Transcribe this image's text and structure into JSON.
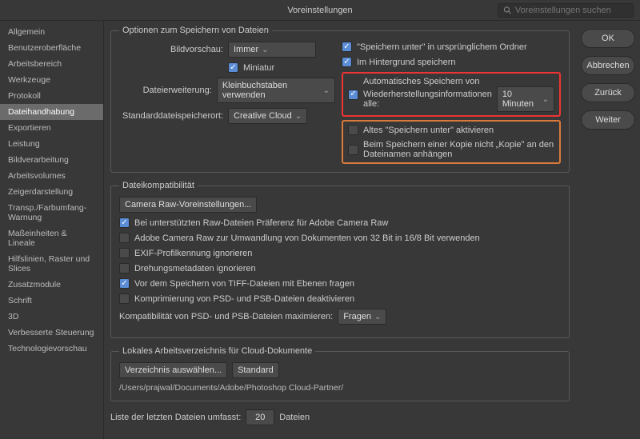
{
  "title": "Voreinstellungen",
  "searchPlaceholder": "Voreinstellungen suchen",
  "sidebar": {
    "items": [
      {
        "label": "Allgemein"
      },
      {
        "label": "Benutzeroberfläche"
      },
      {
        "label": "Arbeitsbereich"
      },
      {
        "label": "Werkzeuge"
      },
      {
        "label": "Protokoll"
      },
      {
        "label": "Dateihandhabung"
      },
      {
        "label": "Exportieren"
      },
      {
        "label": "Leistung"
      },
      {
        "label": "Bildverarbeitung"
      },
      {
        "label": "Arbeitsvolumes"
      },
      {
        "label": "Zeigerdarstellung"
      },
      {
        "label": "Transp./Farbumfang-Warnung"
      },
      {
        "label": "Maßeinheiten & Lineale"
      },
      {
        "label": "Hilfslinien, Raster und Slices"
      },
      {
        "label": "Zusatzmodule"
      },
      {
        "label": "Schrift"
      },
      {
        "label": "3D"
      },
      {
        "label": "Verbesserte Steuerung"
      },
      {
        "label": "Technologievorschau"
      }
    ]
  },
  "buttons": {
    "ok": "OK",
    "cancel": "Abbrechen",
    "back": "Zurück",
    "next": "Weiter"
  },
  "fs1": {
    "legend": "Optionen zum Speichern von Dateien",
    "l_preview": "Bildvorschau:",
    "v_preview": "Immer",
    "cb_mini": "Miniatur",
    "l_ext": "Dateierweiterung:",
    "v_ext": "Kleinbuchstaben verwenden",
    "l_loc": "Standarddateispeicherort:",
    "v_loc": "Creative Cloud",
    "cb_orig": "\"Speichern unter\" in ursprünglichem Ordner",
    "cb_bg": "Im Hintergrund speichern",
    "cb_auto1": "Automatisches Speichern von",
    "cb_auto2": "Wiederherstellungsinformationen alle:",
    "v_auto": "10 Minuten",
    "cb_legacy": "Altes \"Speichern unter\" aktivieren",
    "cb_copy": "Beim Speichern einer Kopie nicht „Kopie\" an den Dateinamen anhängen"
  },
  "fs2": {
    "legend": "Dateikompatibilität",
    "btn_cr": "Camera Raw-Voreinstellungen...",
    "cb1": "Bei unterstützten Raw-Dateien Präferenz für Adobe Camera Raw",
    "cb2": "Adobe Camera Raw zur Umwandlung von Dokumenten von 32 Bit in 16/8 Bit verwenden",
    "cb3": "EXIF-Profilkennung ignorieren",
    "cb4": "Drehungsmetadaten ignorieren",
    "cb5": "Vor dem Speichern von TIFF-Dateien mit Ebenen fragen",
    "cb6": "Komprimierung von PSD- und PSB-Dateien deaktivieren",
    "l_max": "Kompatibilität von PSD- und PSB-Dateien maximieren:",
    "v_max": "Fragen"
  },
  "fs3": {
    "legend": "Lokales Arbeitsverzeichnis für Cloud-Dokumente",
    "btn_dir": "Verzeichnis auswählen...",
    "btn_def": "Standard",
    "path": "/Users/prajwal/Documents/Adobe/Photoshop Cloud-Partner/"
  },
  "recent": {
    "l1": "Liste der letzten Dateien umfasst:",
    "v": "20",
    "l2": "Dateien"
  }
}
